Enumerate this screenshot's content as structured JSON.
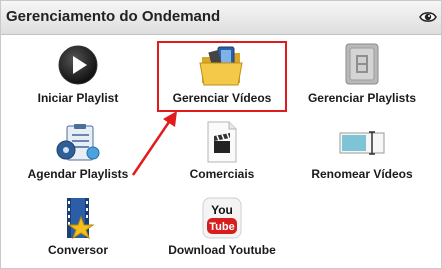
{
  "header": {
    "title": "Gerenciamento do Ondemand",
    "eye_icon": "eye-icon"
  },
  "tiles": [
    {
      "label": "Iniciar Playlist",
      "icon": "play-icon"
    },
    {
      "label": "Gerenciar Vídeos",
      "icon": "folder-video-icon"
    },
    {
      "label": "Gerenciar Playlists",
      "icon": "film-panel-icon"
    },
    {
      "label": "Agendar Playlists",
      "icon": "schedule-clipboard-icon"
    },
    {
      "label": "Comerciais",
      "icon": "clapper-document-icon"
    },
    {
      "label": "Renomear Vídeos",
      "icon": "rename-textbox-icon"
    },
    {
      "label": "Conversor",
      "icon": "film-star-icon"
    },
    {
      "label": "Download Youtube",
      "icon": "youtube-icon"
    }
  ],
  "colors": {
    "highlight": "#e21c1c",
    "arrow": "#e21c1c"
  }
}
